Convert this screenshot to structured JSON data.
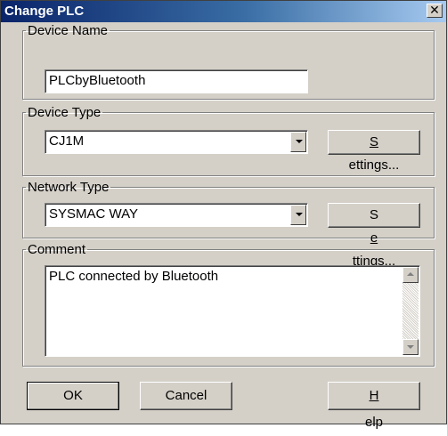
{
  "window": {
    "title": "Change PLC",
    "close_glyph": "✕"
  },
  "device_name": {
    "legend": "Device Name",
    "value": "PLCbyBluetooth"
  },
  "device_type": {
    "legend": "Device Type",
    "selected": "CJ1M",
    "settings_prefix": "",
    "settings_mnemonic": "S",
    "settings_rest": "ettings..."
  },
  "network_type": {
    "legend": "Network Type",
    "selected": "SYSMAC WAY",
    "settings_prefix": "S",
    "settings_mnemonic": "e",
    "settings_rest": "ttings..."
  },
  "comment": {
    "legend": "Comment",
    "value": "PLC connected by Bluetooth"
  },
  "buttons": {
    "ok": "OK",
    "cancel": "Cancel",
    "help_mnemonic": "H",
    "help_rest": "elp"
  }
}
